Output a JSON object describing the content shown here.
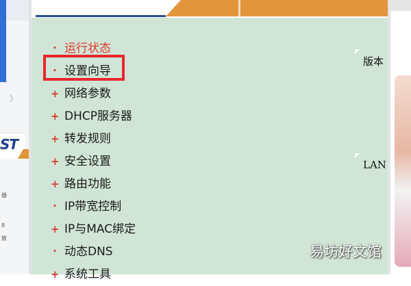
{
  "left_window": {
    "nav_arrow": "〉",
    "logo_text": "ST",
    "tiny_texts": [
      "器",
      "8",
      "致"
    ]
  },
  "menu": {
    "items": [
      {
        "label": "运行状态",
        "bullet": "•",
        "active": true
      },
      {
        "label": "设置向导",
        "bullet": "•",
        "active": false
      },
      {
        "label": "网络参数",
        "bullet": "+",
        "active": false
      },
      {
        "label": "DHCP服务器",
        "bullet": "+",
        "active": false
      },
      {
        "label": "转发规则",
        "bullet": "+",
        "active": false
      },
      {
        "label": "安全设置",
        "bullet": "+",
        "active": false
      },
      {
        "label": "路由功能",
        "bullet": "+",
        "active": false
      },
      {
        "label": "IP带宽控制",
        "bullet": "•",
        "active": false
      },
      {
        "label": "IP与MAC绑定",
        "bullet": "+",
        "active": false
      },
      {
        "label": "动态DNS",
        "bullet": "•",
        "active": false
      },
      {
        "label": "系统工具",
        "bullet": "+",
        "active": false
      }
    ]
  },
  "right_content": {
    "version_label": "版本",
    "lan_label": "LAN"
  },
  "watermark": "易坊好文馆",
  "colors": {
    "panel_bg": "#d0e5d6",
    "accent_orange": "#e3953b",
    "accent_blue": "#2d4d93",
    "menu_active": "#e2392b",
    "highlight_box": "#e8262e"
  }
}
